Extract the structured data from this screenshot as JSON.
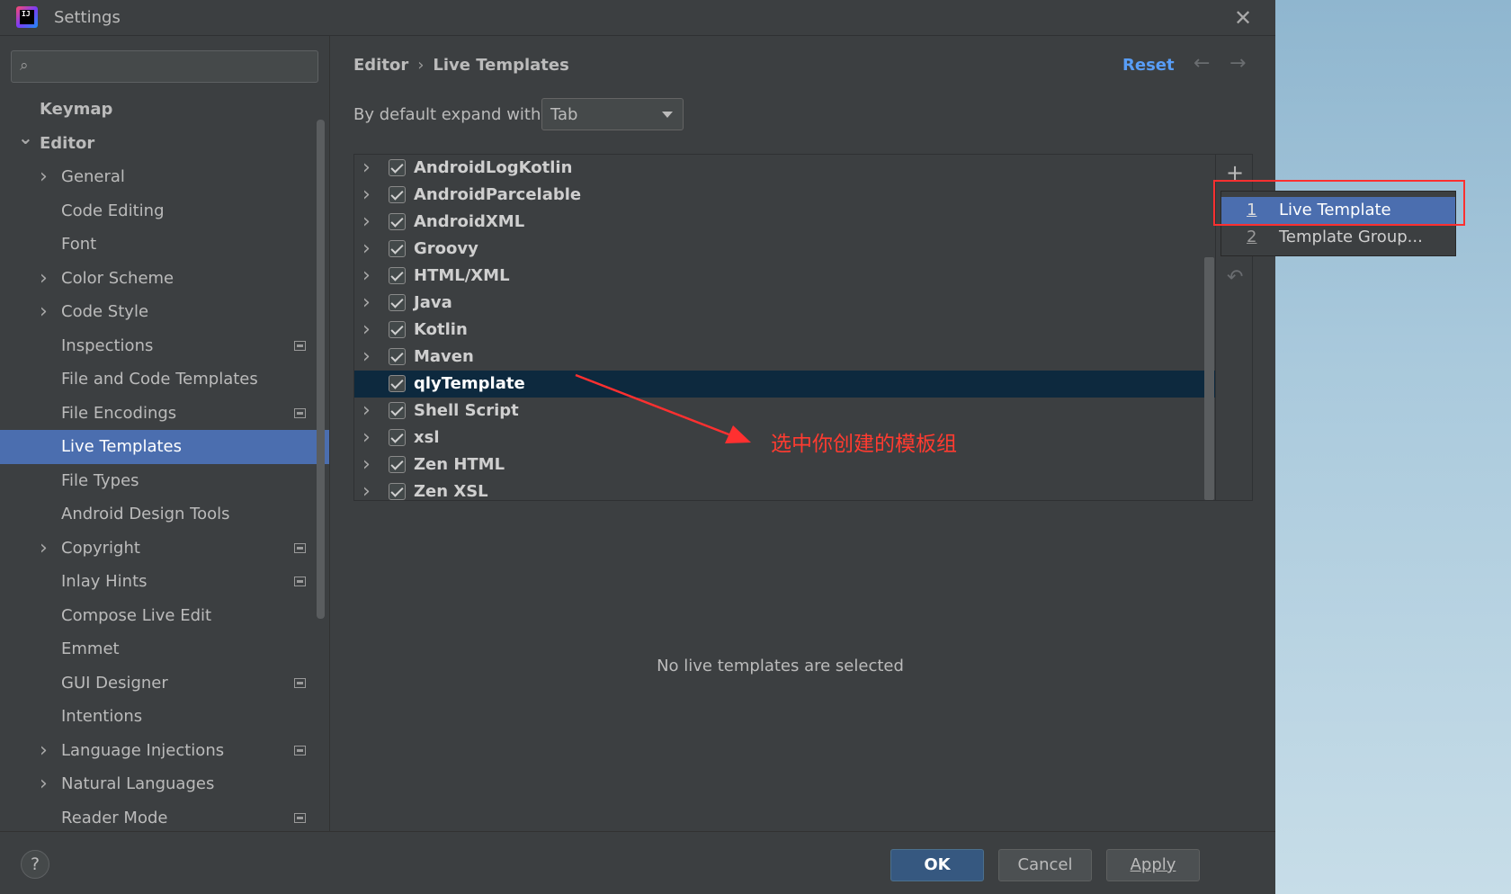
{
  "window": {
    "title": "Settings",
    "app_icon_text": "IJ"
  },
  "search": {
    "value": "",
    "placeholder": ""
  },
  "sidebar": {
    "items": [
      {
        "label": "Keymap",
        "level": 0,
        "bold": true,
        "chevron": "",
        "project_icon": false,
        "selected": false
      },
      {
        "label": "Editor",
        "level": 0,
        "bold": true,
        "chevron": "down",
        "project_icon": false,
        "selected": false
      },
      {
        "label": "General",
        "level": 1,
        "bold": false,
        "chevron": "right",
        "project_icon": false,
        "selected": false
      },
      {
        "label": "Code Editing",
        "level": 1,
        "bold": false,
        "chevron": "",
        "project_icon": false,
        "selected": false
      },
      {
        "label": "Font",
        "level": 1,
        "bold": false,
        "chevron": "",
        "project_icon": false,
        "selected": false
      },
      {
        "label": "Color Scheme",
        "level": 1,
        "bold": false,
        "chevron": "right",
        "project_icon": false,
        "selected": false
      },
      {
        "label": "Code Style",
        "level": 1,
        "bold": false,
        "chevron": "right",
        "project_icon": false,
        "selected": false
      },
      {
        "label": "Inspections",
        "level": 1,
        "bold": false,
        "chevron": "",
        "project_icon": true,
        "selected": false
      },
      {
        "label": "File and Code Templates",
        "level": 1,
        "bold": false,
        "chevron": "",
        "project_icon": false,
        "selected": false
      },
      {
        "label": "File Encodings",
        "level": 1,
        "bold": false,
        "chevron": "",
        "project_icon": true,
        "selected": false
      },
      {
        "label": "Live Templates",
        "level": 1,
        "bold": false,
        "chevron": "",
        "project_icon": false,
        "selected": true
      },
      {
        "label": "File Types",
        "level": 1,
        "bold": false,
        "chevron": "",
        "project_icon": false,
        "selected": false
      },
      {
        "label": "Android Design Tools",
        "level": 1,
        "bold": false,
        "chevron": "",
        "project_icon": false,
        "selected": false
      },
      {
        "label": "Copyright",
        "level": 1,
        "bold": false,
        "chevron": "right",
        "project_icon": true,
        "selected": false
      },
      {
        "label": "Inlay Hints",
        "level": 1,
        "bold": false,
        "chevron": "",
        "project_icon": true,
        "selected": false
      },
      {
        "label": "Compose Live Edit",
        "level": 1,
        "bold": false,
        "chevron": "",
        "project_icon": false,
        "selected": false
      },
      {
        "label": "Emmet",
        "level": 1,
        "bold": false,
        "chevron": "",
        "project_icon": false,
        "selected": false
      },
      {
        "label": "GUI Designer",
        "level": 1,
        "bold": false,
        "chevron": "",
        "project_icon": true,
        "selected": false
      },
      {
        "label": "Intentions",
        "level": 1,
        "bold": false,
        "chevron": "",
        "project_icon": false,
        "selected": false
      },
      {
        "label": "Language Injections",
        "level": 1,
        "bold": false,
        "chevron": "right",
        "project_icon": true,
        "selected": false
      },
      {
        "label": "Natural Languages",
        "level": 1,
        "bold": false,
        "chevron": "right",
        "project_icon": false,
        "selected": false
      },
      {
        "label": "Reader Mode",
        "level": 1,
        "bold": false,
        "chevron": "",
        "project_icon": true,
        "selected": false
      }
    ]
  },
  "header": {
    "breadcrumb_parent": "Editor",
    "breadcrumb_separator": "›",
    "breadcrumb_current": "Live Templates",
    "reset_label": "Reset",
    "back_arrow": "←",
    "forward_arrow": "→"
  },
  "expand": {
    "label": "By default expand with",
    "selected": "Tab"
  },
  "templates": [
    {
      "label": "AndroidLogKotlin",
      "checked": true,
      "expandable": true,
      "selected": false
    },
    {
      "label": "AndroidParcelable",
      "checked": true,
      "expandable": true,
      "selected": false
    },
    {
      "label": "AndroidXML",
      "checked": true,
      "expandable": true,
      "selected": false
    },
    {
      "label": "Groovy",
      "checked": true,
      "expandable": true,
      "selected": false
    },
    {
      "label": "HTML/XML",
      "checked": true,
      "expandable": true,
      "selected": false
    },
    {
      "label": "Java",
      "checked": true,
      "expandable": true,
      "selected": false
    },
    {
      "label": "Kotlin",
      "checked": true,
      "expandable": true,
      "selected": false
    },
    {
      "label": "Maven",
      "checked": true,
      "expandable": true,
      "selected": false
    },
    {
      "label": "qlyTemplate",
      "checked": true,
      "expandable": false,
      "selected": true
    },
    {
      "label": "Shell Script",
      "checked": true,
      "expandable": true,
      "selected": false
    },
    {
      "label": "xsl",
      "checked": true,
      "expandable": true,
      "selected": false
    },
    {
      "label": "Zen HTML",
      "checked": true,
      "expandable": true,
      "selected": false
    },
    {
      "label": "Zen XSL",
      "checked": true,
      "expandable": true,
      "selected": false
    }
  ],
  "toolbar": {
    "add_symbol": "+",
    "undo_symbol": "↶"
  },
  "popup": {
    "items": [
      {
        "num": "1",
        "label": "Live Template",
        "active": true
      },
      {
        "num": "2",
        "label": "Template Group...",
        "active": false
      }
    ]
  },
  "annotation": {
    "text": "选中你创建的模板组",
    "color": "#ff3b30"
  },
  "empty_message": "No live templates are selected",
  "footer": {
    "help_symbol": "?",
    "ok_label": "OK",
    "cancel_label": "Cancel",
    "apply_label": "Apply"
  },
  "colors": {
    "background": "#3c3f41",
    "selection": "#4b6eaf",
    "tree_selection": "#0d293e",
    "link": "#589df6",
    "primary_button": "#365880",
    "highlight": "#ff3030"
  }
}
